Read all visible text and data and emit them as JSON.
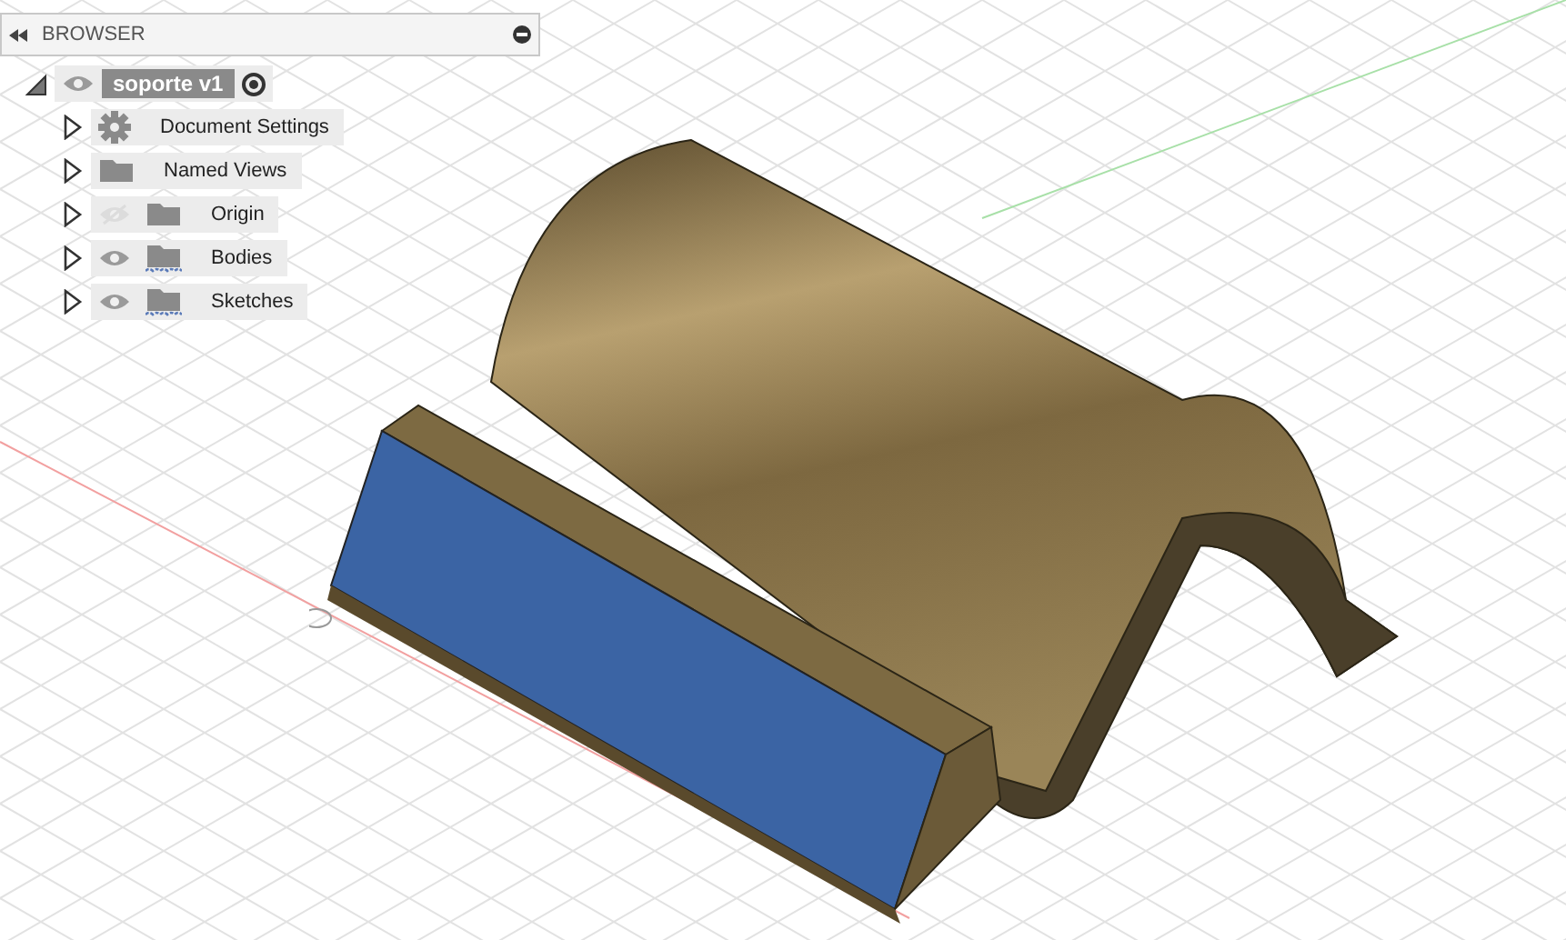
{
  "browser": {
    "title": "BROWSER",
    "root": {
      "label": "soporte v1",
      "visible": true,
      "expanded": true
    },
    "items": [
      {
        "label": "Document Settings",
        "kind": "settings"
      },
      {
        "label": "Named Views",
        "kind": "folder"
      },
      {
        "label": "Origin",
        "kind": "folder",
        "visible": false
      },
      {
        "label": "Bodies",
        "kind": "linked-folder",
        "visible": true
      },
      {
        "label": "Sketches",
        "kind": "linked-folder",
        "visible": true
      }
    ]
  }
}
